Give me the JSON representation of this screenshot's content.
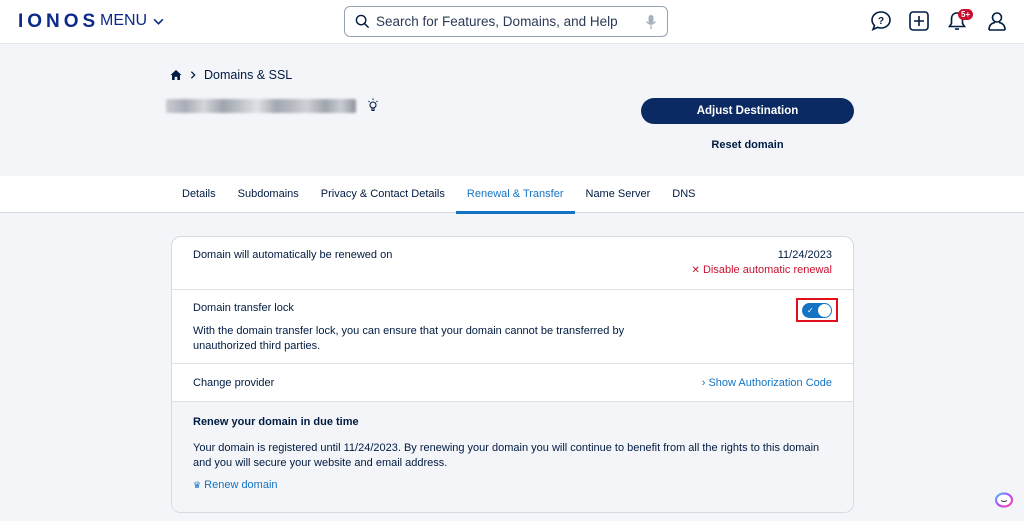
{
  "header": {
    "logo": "IONOS",
    "menu_label": "MENU",
    "search_placeholder": "Search for Features, Domains, and Help",
    "notification_badge": "5+",
    "icons": [
      "help-chat-icon",
      "add-icon",
      "bell-icon",
      "user-icon"
    ]
  },
  "breadcrumb": {
    "home_icon": "home-icon",
    "current": "Domains & SSL"
  },
  "domain": {
    "name_blurred": true
  },
  "actions": {
    "adjust_destination": "Adjust Destination",
    "reset_domain": "Reset domain"
  },
  "tabs": [
    {
      "label": "Details",
      "active": false
    },
    {
      "label": "Subdomains",
      "active": false
    },
    {
      "label": "Privacy & Contact Details",
      "active": false
    },
    {
      "label": "Renewal & Transfer",
      "active": true
    },
    {
      "label": "Name Server",
      "active": false
    },
    {
      "label": "DNS",
      "active": false
    }
  ],
  "renewal": {
    "label": "Domain will automatically be renewed on",
    "date": "11/24/2023",
    "disable_label": "Disable automatic renewal"
  },
  "transfer_lock": {
    "label": "Domain transfer lock",
    "description": "With the domain transfer lock, you can ensure that your domain cannot be transferred by unauthorized third parties.",
    "enabled": true
  },
  "change_provider": {
    "label": "Change provider",
    "link": "Show Authorization Code"
  },
  "renew_info": {
    "title": "Renew your domain in due time",
    "text": "Your domain is registered until 11/24/2023. By renewing your domain you will continue to benefit from all the rights to this domain and you will secure your website and email address.",
    "link": "Renew domain"
  },
  "colors": {
    "brand": "#0b2a8a",
    "primary_button": "#0b2a63",
    "link": "#1474c4",
    "danger": "#c8102e",
    "highlight_box": "#e0101c"
  }
}
